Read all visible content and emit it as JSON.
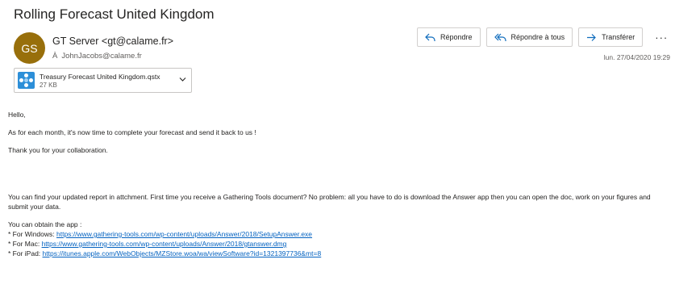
{
  "email": {
    "subject": "Rolling Forecast United Kingdom",
    "avatar_initials": "GS",
    "avatar_color": "#986f0b",
    "sender": "GT Server <gt@calame.fr>",
    "to_label": "À",
    "recipient": "JohnJacobs@calame.fr",
    "date": "lun. 27/04/2020 19:29"
  },
  "actions": {
    "reply": "Répondre",
    "reply_all": "Répondre à tous",
    "forward": "Transférer",
    "more": "···"
  },
  "attachment": {
    "icon": "answer-app-icon",
    "name": "Treasury Forecast United Kingdom.qstx",
    "size": "27 KB"
  },
  "body": {
    "greeting": "Hello,",
    "line1": "As for each month, it's now time to complete your forecast and send it back to us !",
    "line2": "Thank you for your collaboration.",
    "para1": "You can find your updated report in attchment. First time you receive a Gathering Tools document? No problem: all you have to do is download the Answer app then you can open the doc, work on your figures and submit your data.",
    "obtain": "You can obtain the app :",
    "windows_label": "* For Windows: ",
    "windows_link": "https://www.gathering-tools.com/wp-content/uploads/Answer/2018/SetupAnswer.exe",
    "mac_label": "* For Mac: ",
    "mac_link": "https://www.gathering-tools.com/wp-content/uploads/Answer/2018/gtanswer.dmg",
    "ipad_label": "* For iPad: ",
    "ipad_link": "https://itunes.apple.com/WebObjects/MZStore.woa/wa/viewSoftware?id=1321397736&mt=8"
  },
  "colors": {
    "link": "#0563c1",
    "icon_accent": "#2d8fd8"
  }
}
